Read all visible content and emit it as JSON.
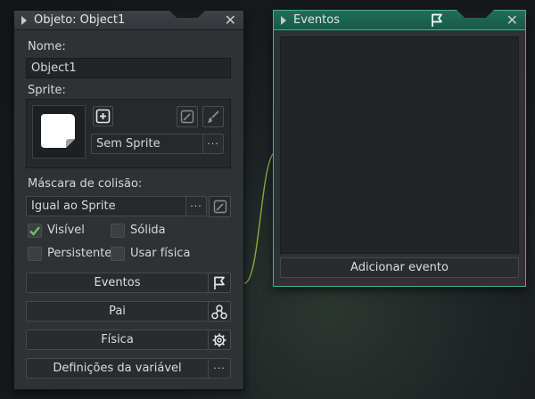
{
  "object_panel": {
    "title": "Objeto: Object1",
    "close": "✕",
    "name_label": "Nome:",
    "name_value": "Object1",
    "sprite_label": "Sprite:",
    "sprite_value": "Sem Sprite",
    "sprite_browse": "···",
    "mask_label": "Máscara de colisão:",
    "mask_value": "Igual ao Sprite",
    "mask_browse": "···",
    "checkboxes": {
      "visible": {
        "label": "Visível",
        "checked": true
      },
      "solid": {
        "label": "Sólida",
        "checked": false
      },
      "persistent": {
        "label": "Persistente",
        "checked": false
      },
      "physics": {
        "label": "Usar física",
        "checked": false
      }
    },
    "buttons": {
      "events": "Eventos",
      "parent": "Pai",
      "physics": "Física",
      "variables": "Definições da variável",
      "variables_more": "···"
    }
  },
  "events_panel": {
    "title": "Eventos",
    "close": "✕",
    "add_event": "Adicionar evento"
  },
  "colors": {
    "accent_green": "#3fb58a",
    "panel_bg": "#2f3134",
    "check_green": "#6fc25a"
  },
  "icons": [
    "flag-icon",
    "parent-nodes-icon",
    "gear-icon",
    "new-sprite-icon",
    "edit-image-icon",
    "brush-icon",
    "check-icon"
  ]
}
